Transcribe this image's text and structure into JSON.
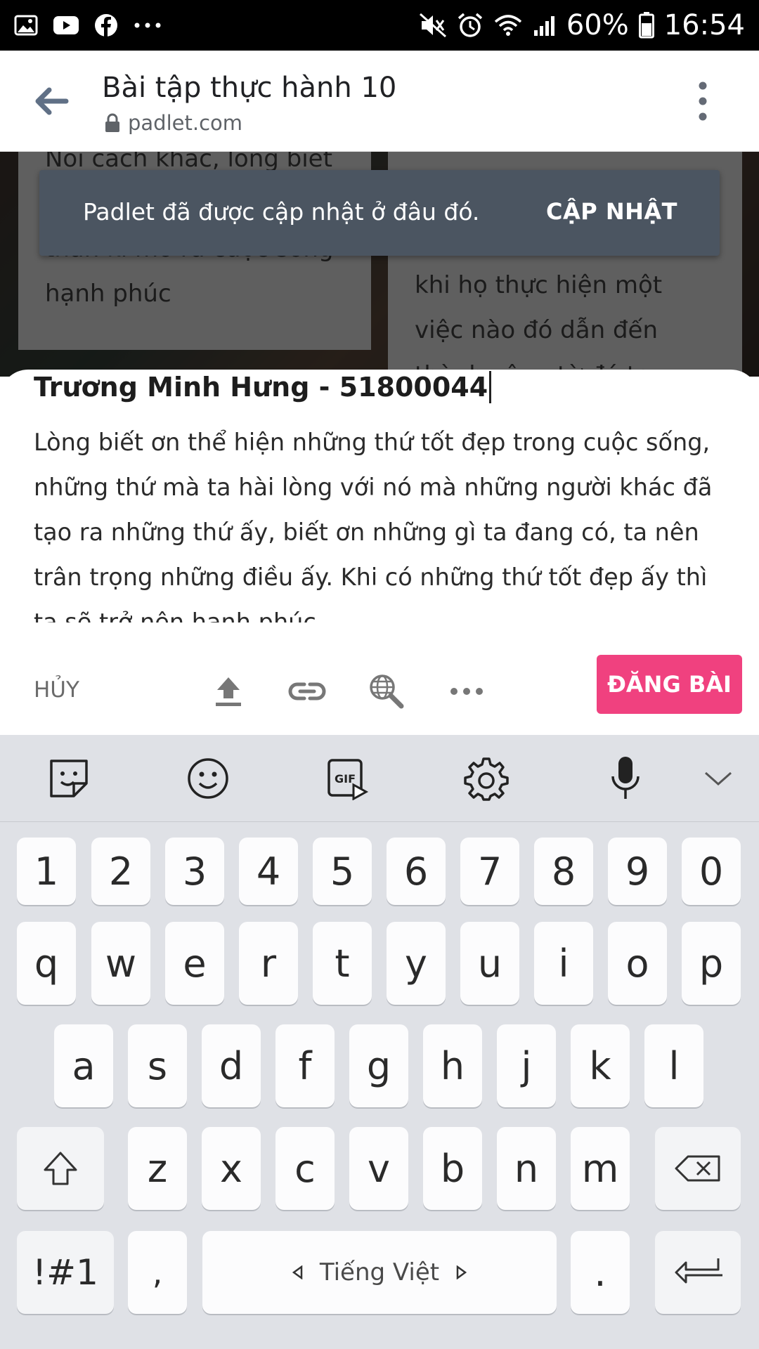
{
  "status_bar": {
    "battery": "60%",
    "time": "16:54",
    "left_icons": [
      "gallery-icon",
      "youtube-icon",
      "facebook-icon",
      "more-icon"
    ],
    "right_icons": [
      "mute-icon",
      "alarm-icon",
      "wifi-icon",
      "signal-icon",
      "battery-icon"
    ]
  },
  "browser": {
    "title": "Bài tập thực hành 10",
    "url": "padlet.com"
  },
  "background_cards": {
    "left_lines": [
      "Nói cách khác, lòng biết",
      "thân kì mở ra cuộc sống",
      "hạnh phúc"
    ],
    "right_lines": [
      "khi họ thực hiện một",
      "việc nào đó dẫn đến",
      "thành công từ đó tạo ra"
    ]
  },
  "toast": {
    "message": "Padlet đã được cập nhật ở đâu đó.",
    "action": "CẬP NHẬT"
  },
  "composer": {
    "title": "Trương Minh Hưng - 51800044",
    "body_lines": [
      "Lòng biết ơn thể hiện những thứ tốt đẹp trong cuộc sống,",
      "những thứ mà ta hài lòng với nó mà những người khác đã",
      "tạo ra những thứ ấy, biết ơn những gì ta đang có, ta nên",
      "trân trọng những điều ấy. Khi có những thứ tốt đẹp ấy thì",
      "ta sẽ trở nên hạnh phúc."
    ],
    "cancel_label": "HỦY",
    "post_label": "ĐĂNG BÀI",
    "accent_color": "#f0417f"
  },
  "keyboard": {
    "toolbar": [
      "sticker-icon",
      "emoji-icon",
      "gif-icon",
      "settings-icon",
      "microphone-icon",
      "collapse-icon"
    ],
    "gif_label": "GIF",
    "numbers": [
      "1",
      "2",
      "3",
      "4",
      "5",
      "6",
      "7",
      "8",
      "9",
      "0"
    ],
    "row1": [
      "q",
      "w",
      "e",
      "r",
      "t",
      "y",
      "u",
      "i",
      "o",
      "p"
    ],
    "row2": [
      "a",
      "s",
      "d",
      "f",
      "g",
      "h",
      "j",
      "k",
      "l"
    ],
    "row3": [
      "z",
      "x",
      "c",
      "v",
      "b",
      "n",
      "m"
    ],
    "symbols_label": "!#1",
    "comma": ",",
    "language": "Tiếng Việt",
    "period": "."
  }
}
